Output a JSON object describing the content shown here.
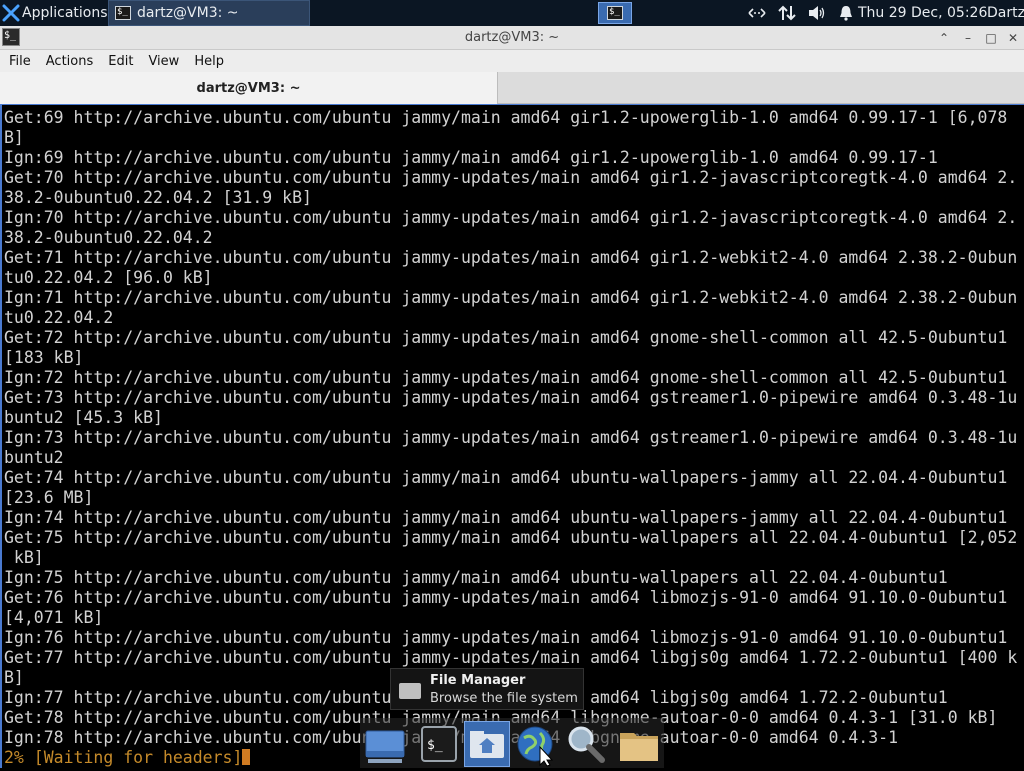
{
  "panel": {
    "applications_label": "Applications",
    "task_window_label": "dartz@VM3: ~",
    "clock": "Thu 29 Dec, 05:26",
    "user": "Dartz"
  },
  "window": {
    "title": "dartz@VM3: ~",
    "menu": [
      "File",
      "Actions",
      "Edit",
      "View",
      "Help"
    ],
    "tab_label": "dartz@VM3: ~"
  },
  "terminal": {
    "lines": [
      "Get:69 http://archive.ubuntu.com/ubuntu jammy/main amd64 gir1.2-upowerglib-1.0 amd64 0.99.17-1 [6,078",
      "B]",
      "Ign:69 http://archive.ubuntu.com/ubuntu jammy/main amd64 gir1.2-upowerglib-1.0 amd64 0.99.17-1",
      "Get:70 http://archive.ubuntu.com/ubuntu jammy-updates/main amd64 gir1.2-javascriptcoregtk-4.0 amd64 2.",
      "38.2-0ubuntu0.22.04.2 [31.9 kB]",
      "Ign:70 http://archive.ubuntu.com/ubuntu jammy-updates/main amd64 gir1.2-javascriptcoregtk-4.0 amd64 2.",
      "38.2-0ubuntu0.22.04.2",
      "Get:71 http://archive.ubuntu.com/ubuntu jammy-updates/main amd64 gir1.2-webkit2-4.0 amd64 2.38.2-0ubun",
      "tu0.22.04.2 [96.0 kB]",
      "Ign:71 http://archive.ubuntu.com/ubuntu jammy-updates/main amd64 gir1.2-webkit2-4.0 amd64 2.38.2-0ubun",
      "tu0.22.04.2",
      "Get:72 http://archive.ubuntu.com/ubuntu jammy-updates/main amd64 gnome-shell-common all 42.5-0ubuntu1",
      "[183 kB]",
      "Ign:72 http://archive.ubuntu.com/ubuntu jammy-updates/main amd64 gnome-shell-common all 42.5-0ubuntu1",
      "Get:73 http://archive.ubuntu.com/ubuntu jammy-updates/main amd64 gstreamer1.0-pipewire amd64 0.3.48-1u",
      "buntu2 [45.3 kB]",
      "Ign:73 http://archive.ubuntu.com/ubuntu jammy-updates/main amd64 gstreamer1.0-pipewire amd64 0.3.48-1u",
      "buntu2",
      "Get:74 http://archive.ubuntu.com/ubuntu jammy/main amd64 ubuntu-wallpapers-jammy all 22.04.4-0ubuntu1",
      "[23.6 MB]",
      "Ign:74 http://archive.ubuntu.com/ubuntu jammy/main amd64 ubuntu-wallpapers-jammy all 22.04.4-0ubuntu1",
      "Get:75 http://archive.ubuntu.com/ubuntu jammy/main amd64 ubuntu-wallpapers all 22.04.4-0ubuntu1 [2,052",
      " kB]",
      "Ign:75 http://archive.ubuntu.com/ubuntu jammy/main amd64 ubuntu-wallpapers all 22.04.4-0ubuntu1",
      "Get:76 http://archive.ubuntu.com/ubuntu jammy-updates/main amd64 libmozjs-91-0 amd64 91.10.0-0ubuntu1",
      "[4,071 kB]",
      "Ign:76 http://archive.ubuntu.com/ubuntu jammy-updates/main amd64 libmozjs-91-0 amd64 91.10.0-0ubuntu1",
      "Get:77 http://archive.ubuntu.com/ubuntu jammy-updates/main amd64 libgjs0g amd64 1.72.2-0ubuntu1 [400 k",
      "B]",
      "Ign:77 http://archive.ubuntu.com/ubuntu jammy-updates/main amd64 libgjs0g amd64 1.72.2-0ubuntu1",
      "Get:78 http://archive.ubuntu.com/ubuntu jammy/main amd64 libgnome-autoar-0-0 amd64 0.4.3-1 [31.0 kB]",
      "Ign:78 http://archive.ubuntu.com/ubuntu jammy/main amd64 libgnome-autoar-0-0 amd64 0.4.3-1"
    ],
    "status": "2% [Waiting for headers]"
  },
  "tooltip": {
    "title": "File Manager",
    "description": "Browse the file system"
  },
  "dock": {
    "items": [
      "show-desktop",
      "terminal",
      "home-folder",
      "web-browser",
      "app-finder",
      "files"
    ]
  }
}
